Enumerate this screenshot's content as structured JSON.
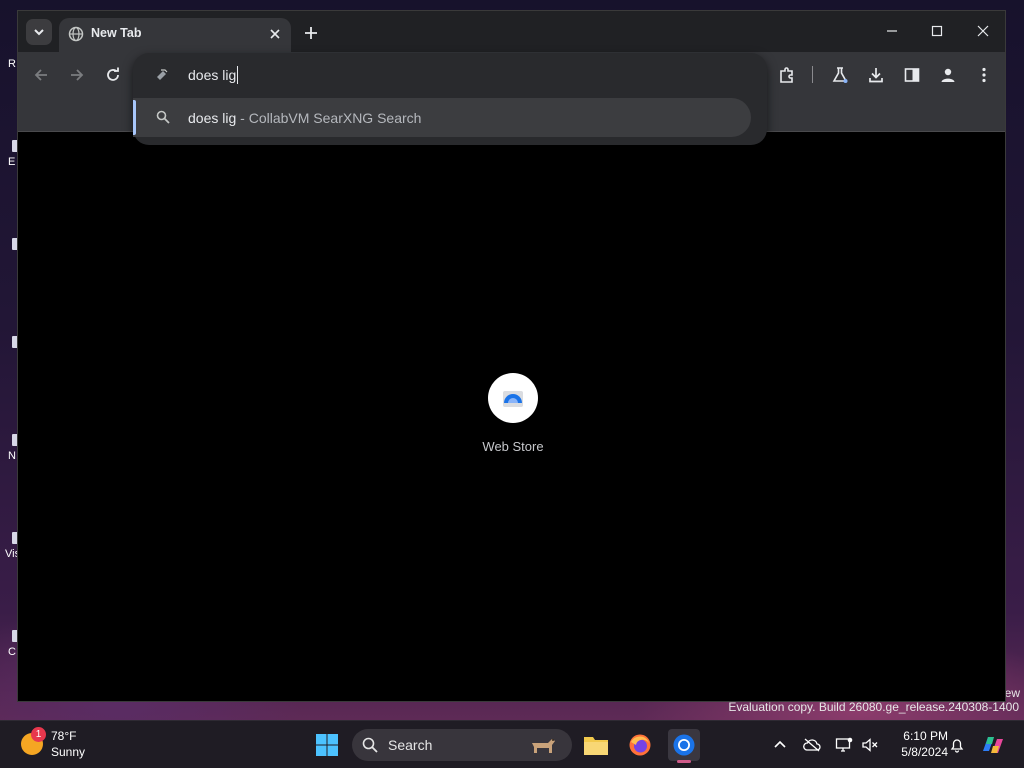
{
  "desktop": {
    "icon_labels": [
      "R",
      "E",
      "N",
      "Vis",
      "C"
    ],
    "watermark_line1": "ew",
    "watermark_line2": "Evaluation copy. Build 26080.ge_release.240308-1400"
  },
  "browser": {
    "tab": {
      "title": "New Tab",
      "favicon": "globe-icon"
    },
    "omnibox": {
      "value": "does lig",
      "icon": "searxng-icon",
      "suggestions": [
        {
          "query": "does lig",
          "description": " - CollabVM SearXNG Search",
          "icon": "search-icon"
        }
      ]
    },
    "shortcut": {
      "label": "Web Store",
      "icon": "webstore-icon"
    }
  },
  "taskbar": {
    "weather": {
      "temp": "78°F",
      "condition": "Sunny",
      "badge": "1"
    },
    "search_label": "Search",
    "clock": {
      "time": "6:10 PM",
      "date": "5/8/2024"
    }
  }
}
